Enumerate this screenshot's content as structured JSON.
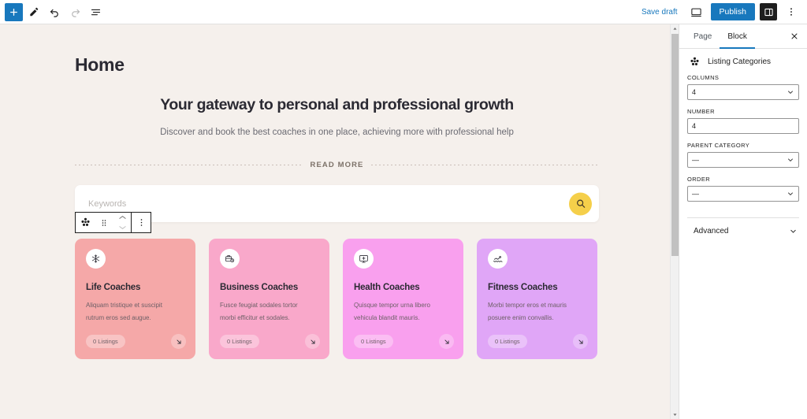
{
  "topbar": {
    "add_block_label": "+",
    "tools": [
      "edit-pen",
      "undo",
      "redo",
      "list-view"
    ],
    "save_draft_label": "Save draft",
    "preview_label": "preview",
    "publish_label": "Publish",
    "settings_label": "settings",
    "options_label": "options"
  },
  "canvas": {
    "page_title": "Home",
    "hero_title": "Your gateway to personal and professional growth",
    "hero_subtitle": "Discover and book the best coaches in one place, achieving more with professional help",
    "read_more_label": "READ MORE",
    "search": {
      "placeholder": "Keywords",
      "button_icon": "search-icon"
    },
    "block_toolbar": {
      "block_icon": "listing-categories-icon",
      "drag_label": "drag",
      "move_up_label": "move up",
      "move_down_label": "move down",
      "options_label": "options"
    },
    "cards": [
      {
        "title": "Life Coaches",
        "description": "Aliquam tristique et suscipit rutrum eros sed augue.",
        "listings": "0 Listings",
        "color": "#f5a8a8",
        "icon": "snowflake-icon"
      },
      {
        "title": "Business Coaches",
        "description": "Fusce feugiat sodales tortor morbi efficitur et sodales.",
        "listings": "0 Listings",
        "color": "#f9a8ca",
        "icon": "briefcase-clock-icon"
      },
      {
        "title": "Health Coaches",
        "description": "Quisque tempor urna libero vehicula blandit mauris.",
        "listings": "0 Listings",
        "color": "#f9a0ee",
        "icon": "monitor-plus-icon"
      },
      {
        "title": "Fitness Coaches",
        "description": "Morbi tempor eros et mauris posuere enim convallis.",
        "listings": "0 Listings",
        "color": "#e0a6f7",
        "icon": "swimmer-icon"
      }
    ]
  },
  "sidebar": {
    "tabs": [
      {
        "label": "Page",
        "active": false
      },
      {
        "label": "Block",
        "active": true
      }
    ],
    "close_label": "close",
    "block_name": "Listing Categories",
    "fields": [
      {
        "label": "COLUMNS",
        "value": "4",
        "type": "select"
      },
      {
        "label": "NUMBER",
        "value": "4",
        "type": "text"
      },
      {
        "label": "PARENT CATEGORY",
        "value": "—",
        "type": "select"
      },
      {
        "label": "ORDER",
        "value": "—",
        "type": "select"
      }
    ],
    "advanced_label": "Advanced"
  },
  "colors": {
    "accent": "#1878bd",
    "canvas_bg": "#f5f0ec",
    "search_button": "#f5cf4a"
  }
}
